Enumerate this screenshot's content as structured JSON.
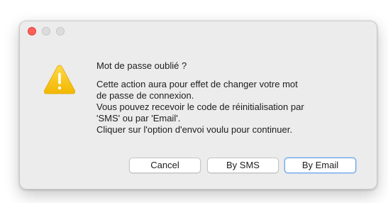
{
  "dialog": {
    "title": "Mot de passe oublié ?",
    "message_lines": [
      "Cette action aura pour effet de changer votre mot",
      "de passe de connexion.",
      "Vous pouvez recevoir le code de réinitialisation par",
      "'SMS' ou par 'Email'.",
      "Cliquer sur l'option d'envoi voulu pour continuer."
    ],
    "icon": "warning-icon",
    "buttons": {
      "cancel": "Cancel",
      "sms": "By SMS",
      "email": "By Email"
    }
  },
  "window_controls": {
    "close": "close-icon",
    "minimize": "minimize-icon",
    "zoom": "zoom-icon"
  },
  "colors": {
    "close_red": "#fe5f57",
    "warning_yellow": "#f5c400",
    "default_button_focus": "#6ea6e8"
  }
}
